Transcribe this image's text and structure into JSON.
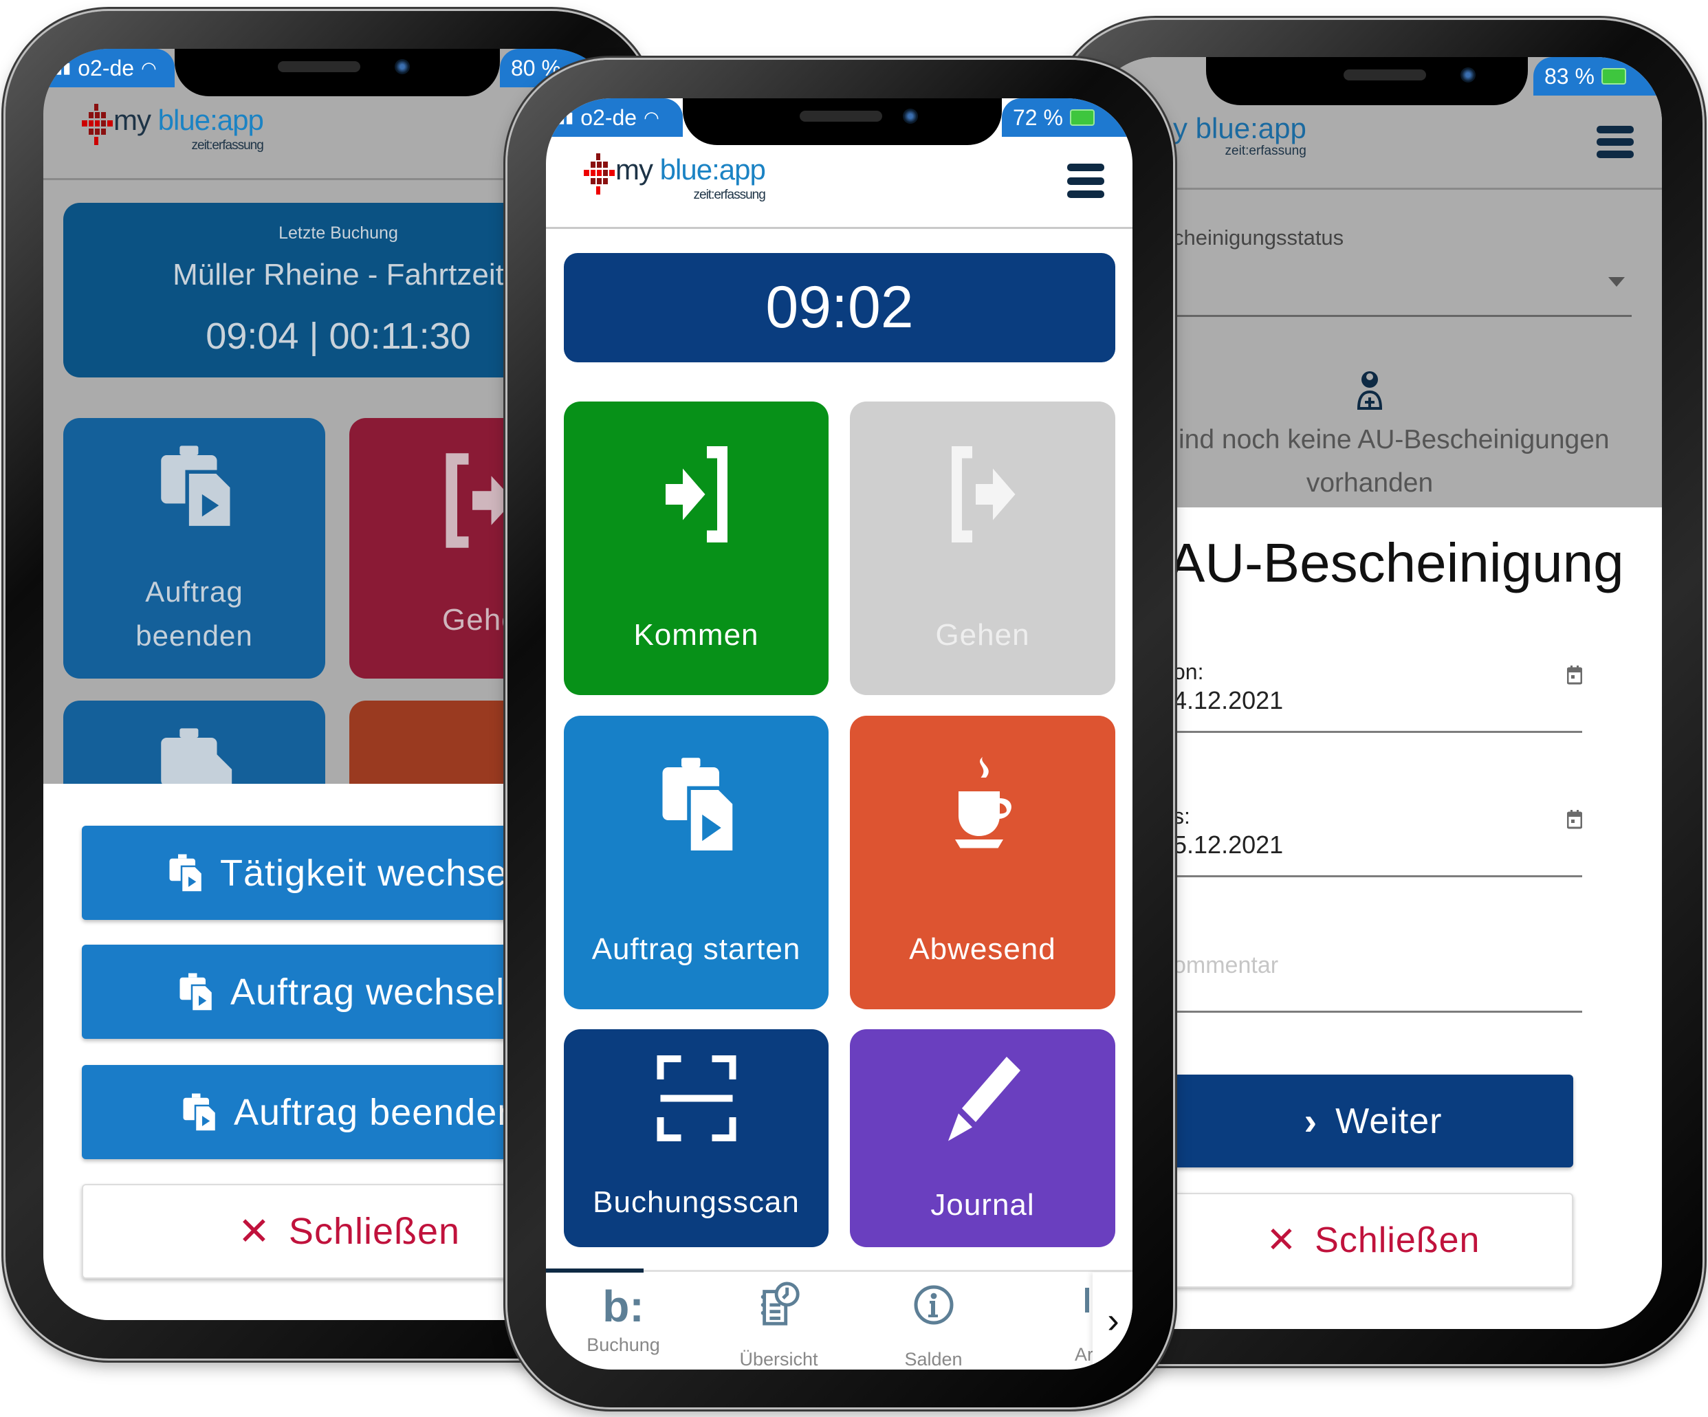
{
  "logo": {
    "text_main_a": "my ",
    "text_main_b": "blue:app",
    "text_sub": "zeit:erfassung"
  },
  "colors": {
    "status_bar": "#1e79d0",
    "time_box": "#0a3d7f",
    "kommen": "#079118",
    "gehen_disabled": "#cfcfcf",
    "auftrag": "#1780c8",
    "abwesend": "#dd5431",
    "buchungsscan": "#0a3d7f",
    "journal": "#6a3fbf",
    "close_red": "#c0123c"
  },
  "left_phone": {
    "status": {
      "carrier": "o2-de",
      "battery": "80 %"
    },
    "last_booking": {
      "label": "Letzte Buchung",
      "title": "Müller Rheine - Fahrtzeit",
      "time": "09:04",
      "duration": "00:11:30",
      "separator": "|"
    },
    "tiles": [
      {
        "label_line1": "Auftrag",
        "label_line2": "beenden",
        "icon": "briefcase-play-icon"
      },
      {
        "label": "Gehe",
        "icon": "logout-icon"
      }
    ],
    "sheet_buttons": [
      {
        "label": "Tätigkeit wechseln",
        "icon": "briefcase-play-icon"
      },
      {
        "label": "Auftrag wechseln",
        "icon": "briefcase-play-icon"
      },
      {
        "label": "Auftrag beenden",
        "icon": "briefcase-play-icon"
      }
    ],
    "close_label": "Schließen"
  },
  "middle_phone": {
    "status": {
      "carrier": "o2-de",
      "battery": "72 %"
    },
    "clock": "09:02",
    "tiles": [
      {
        "label": "Kommen",
        "icon": "login-icon",
        "enabled": true
      },
      {
        "label": "Gehen",
        "icon": "logout-icon",
        "enabled": false
      },
      {
        "label": "Auftrag starten",
        "icon": "briefcase-play-icon",
        "enabled": true
      },
      {
        "label": "Abwesend",
        "icon": "coffee-cup-icon",
        "enabled": true
      },
      {
        "label": "Buchungsscan",
        "icon": "scan-icon",
        "enabled": true
      },
      {
        "label": "Journal",
        "icon": "pencil-icon",
        "enabled": true
      }
    ],
    "bottom_nav": [
      {
        "label": "Buchung",
        "icon": "b-colon-icon",
        "active": true
      },
      {
        "label": "Übersicht",
        "icon": "notebook-clock-icon",
        "active": false
      },
      {
        "label": "Salden",
        "icon": "info-circle-icon",
        "active": false
      },
      {
        "label": "Ar",
        "icon": "partial-icon",
        "active": false
      }
    ]
  },
  "right_phone": {
    "status": {
      "battery": "83 %"
    },
    "logo_partial": "y blue:app",
    "status_filter_label": "cheinigungsstatus",
    "empty_line1": "ind noch keine AU-Bescheinigungen",
    "empty_line2": "vorhanden",
    "form_title": "AU-Bescheinigung",
    "from_label": "on:",
    "from_value": "4.12.2021",
    "to_label": "s:",
    "to_value": "5.12.2021",
    "comment_placeholder": "ommentar",
    "next_label": "Weiter",
    "close_label": "Schließen"
  }
}
